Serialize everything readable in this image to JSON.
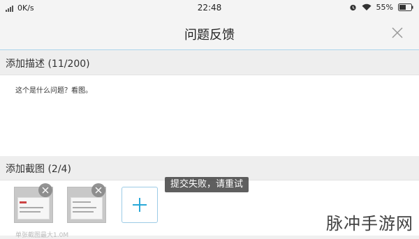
{
  "status_bar": {
    "network_speed": "0K/s",
    "time": "22:48",
    "battery_percent": "55%"
  },
  "header": {
    "title": "问题反馈",
    "close_icon": "close-icon"
  },
  "description": {
    "label": "添加描述 (11/200)",
    "text": "这个是什么问题？看图。"
  },
  "screenshots": {
    "label": "添加截图 (2/4)",
    "count_current": 2,
    "count_max": 4,
    "hint": "单张截图最大1.0M"
  },
  "toast": {
    "message": "提交失败，请重试"
  },
  "watermark": "脉冲手游网",
  "colors": {
    "accent": "#29a8d8",
    "divider": "#a9d4ea"
  }
}
